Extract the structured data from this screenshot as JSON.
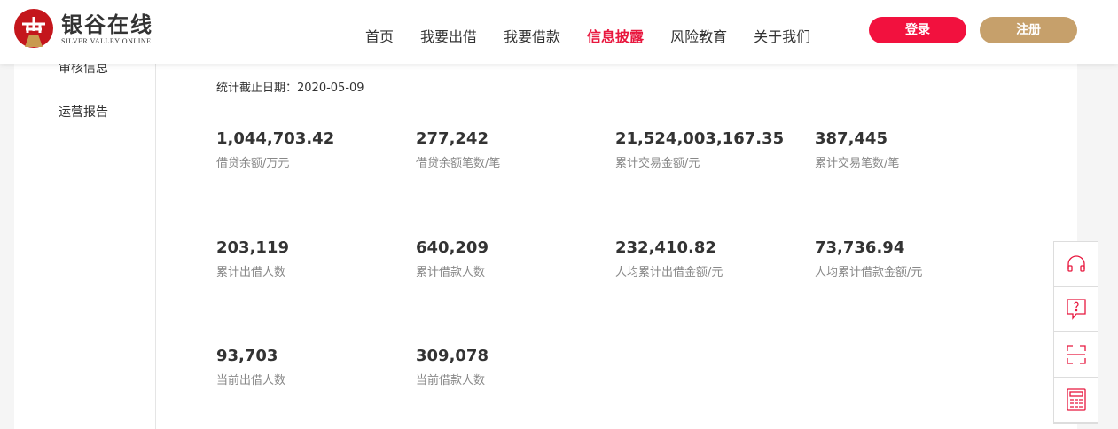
{
  "logo": {
    "cn": "银谷在线",
    "en": "SILVER VALLEY ONLINE"
  },
  "nav": [
    "首页",
    "我要出借",
    "我要借款",
    "信息披露",
    "风险教育",
    "关于我们"
  ],
  "nav_active": 3,
  "buttons": {
    "login": "登录",
    "register": "注册"
  },
  "sidebar": [
    "审核信息",
    "运营报告"
  ],
  "date_label": "统计截止日期：2020-05-09",
  "stats": [
    {
      "value": "1,044,703.42",
      "label": "借贷余额/万元"
    },
    {
      "value": "277,242",
      "label": "借贷余额笔数/笔"
    },
    {
      "value": "21,524,003,167.35",
      "label": "累计交易金额/元"
    },
    {
      "value": "387,445",
      "label": "累计交易笔数/笔"
    },
    {
      "value": "203,119",
      "label": "累计出借人数"
    },
    {
      "value": "640,209",
      "label": "累计借款人数"
    },
    {
      "value": "232,410.82",
      "label": "人均累计出借金额/元"
    },
    {
      "value": "73,736.94",
      "label": "人均累计借款金额/元"
    },
    {
      "value": "93,703",
      "label": "当前出借人数"
    },
    {
      "value": "309,078",
      "label": "当前借款人数"
    }
  ],
  "colors": {
    "accent": "#e8173e",
    "gold": "#c6a06b"
  }
}
